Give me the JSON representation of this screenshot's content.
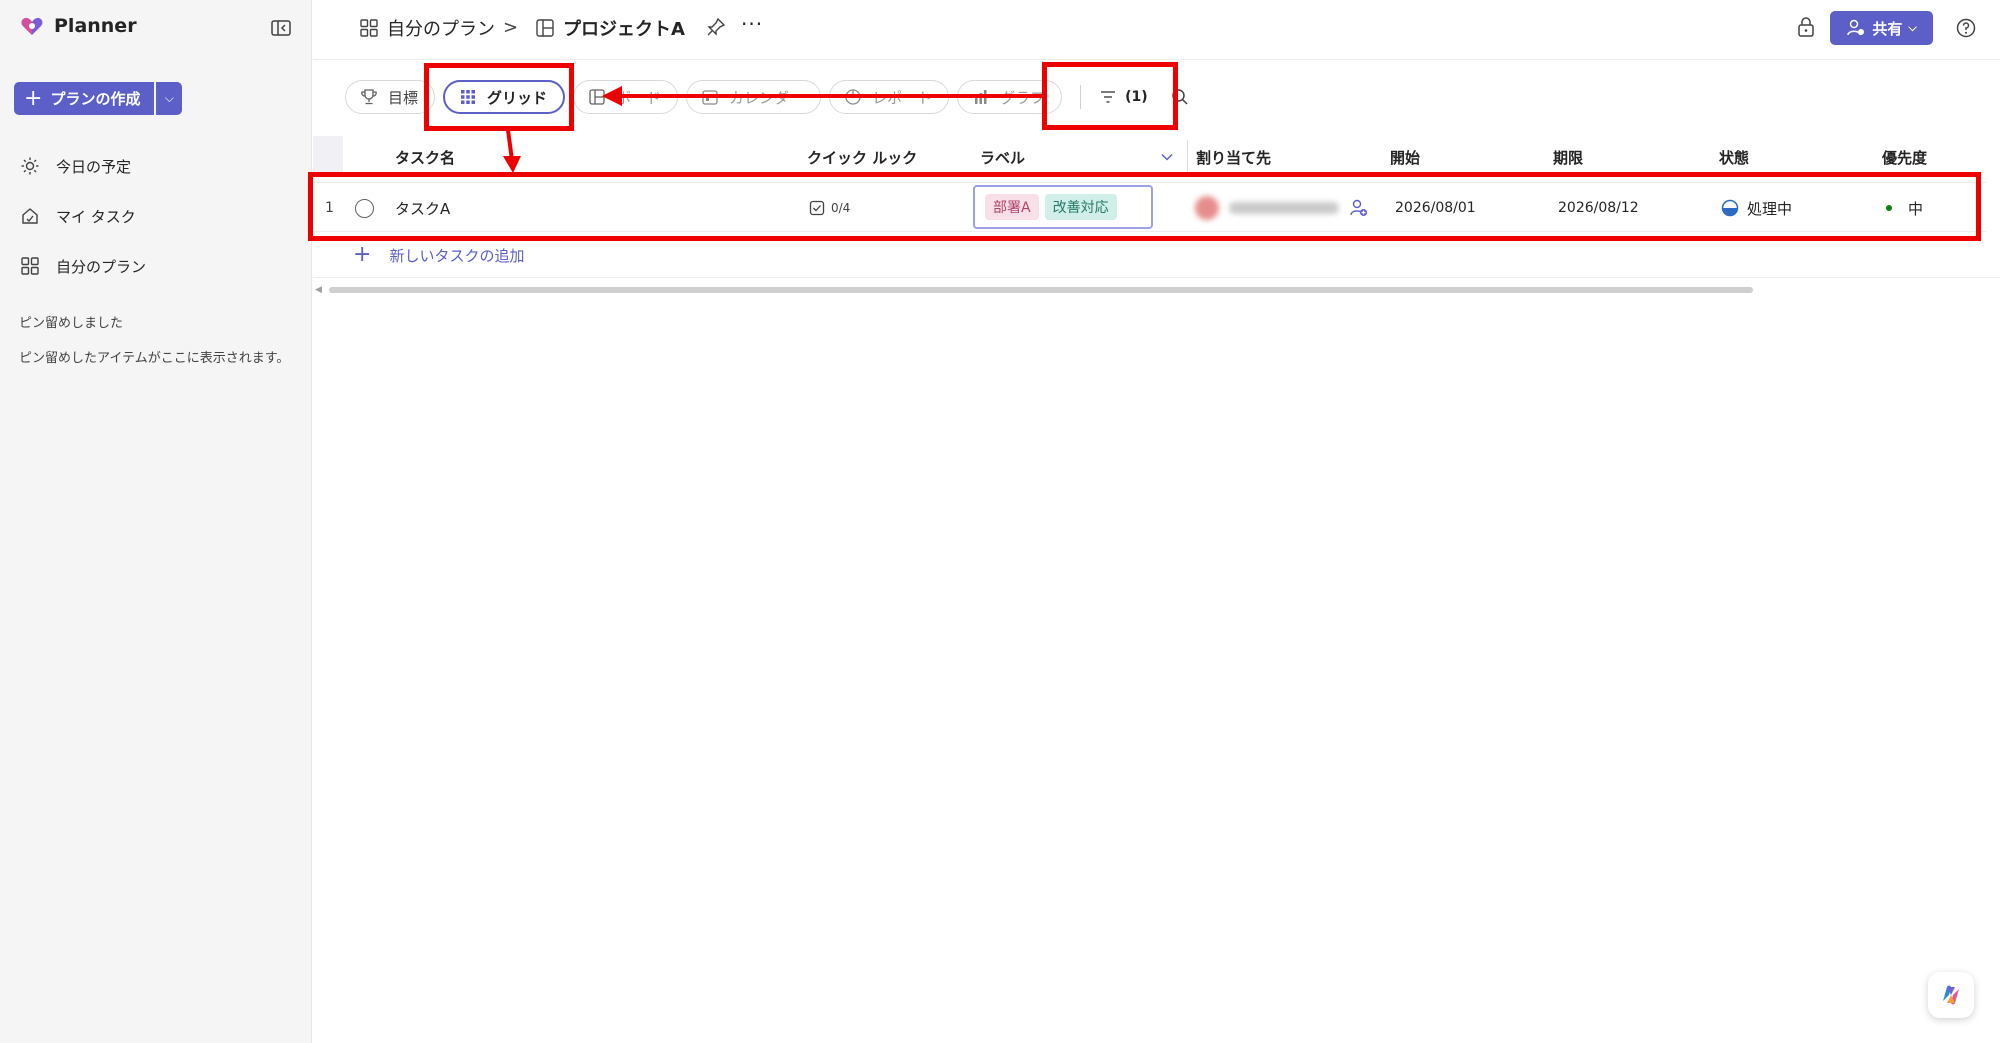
{
  "app": {
    "name": "Planner"
  },
  "sidebar": {
    "create_plan_label": "プランの作成",
    "items": [
      {
        "label": "今日の予定",
        "icon": "sun-icon"
      },
      {
        "label": "マイ タスク",
        "icon": "home-icon"
      },
      {
        "label": "自分のプラン",
        "icon": "grid-icon"
      }
    ],
    "pinned_title": "ピン留めしました",
    "pinned_desc": "ピン留めしたアイテムがここに表示されます。"
  },
  "header": {
    "breadcrumb_plans": "自分のプラン",
    "breadcrumb_sep": ">",
    "project_title": "プロジェクトA",
    "more": "···",
    "share_label": "共有"
  },
  "toolbar": {
    "tabs": [
      {
        "label": "目標",
        "icon": "trophy-icon"
      },
      {
        "label": "グリッド",
        "icon": "grid-dots-icon",
        "active": true
      },
      {
        "label": "ボード",
        "icon": "board-icon"
      },
      {
        "label": "カレンダー",
        "icon": "calendar-icon"
      },
      {
        "label": "レポート",
        "icon": "chart-icon"
      },
      {
        "label": "グラフ",
        "icon": "graph-icon"
      }
    ],
    "filter_count": "(1)"
  },
  "grid": {
    "columns": [
      "タスク名",
      "クイック ルック",
      "ラベル",
      "割り当て先",
      "開始",
      "期限",
      "状態",
      "優先度"
    ],
    "rows": [
      {
        "num": "1",
        "task": "タスクA",
        "checklist": "0/4",
        "labels": [
          "部署A",
          "改善対応"
        ],
        "start": "2026/08/01",
        "due": "2026/08/12",
        "status": "処理中",
        "priority": "中"
      }
    ],
    "add_task_label": "新しいタスクの追加"
  },
  "colors": {
    "accent": "#5b5fc7",
    "annotation": "#ee0000",
    "label_pink": "#f8dfe8",
    "label_teal": "#d2eee8"
  }
}
